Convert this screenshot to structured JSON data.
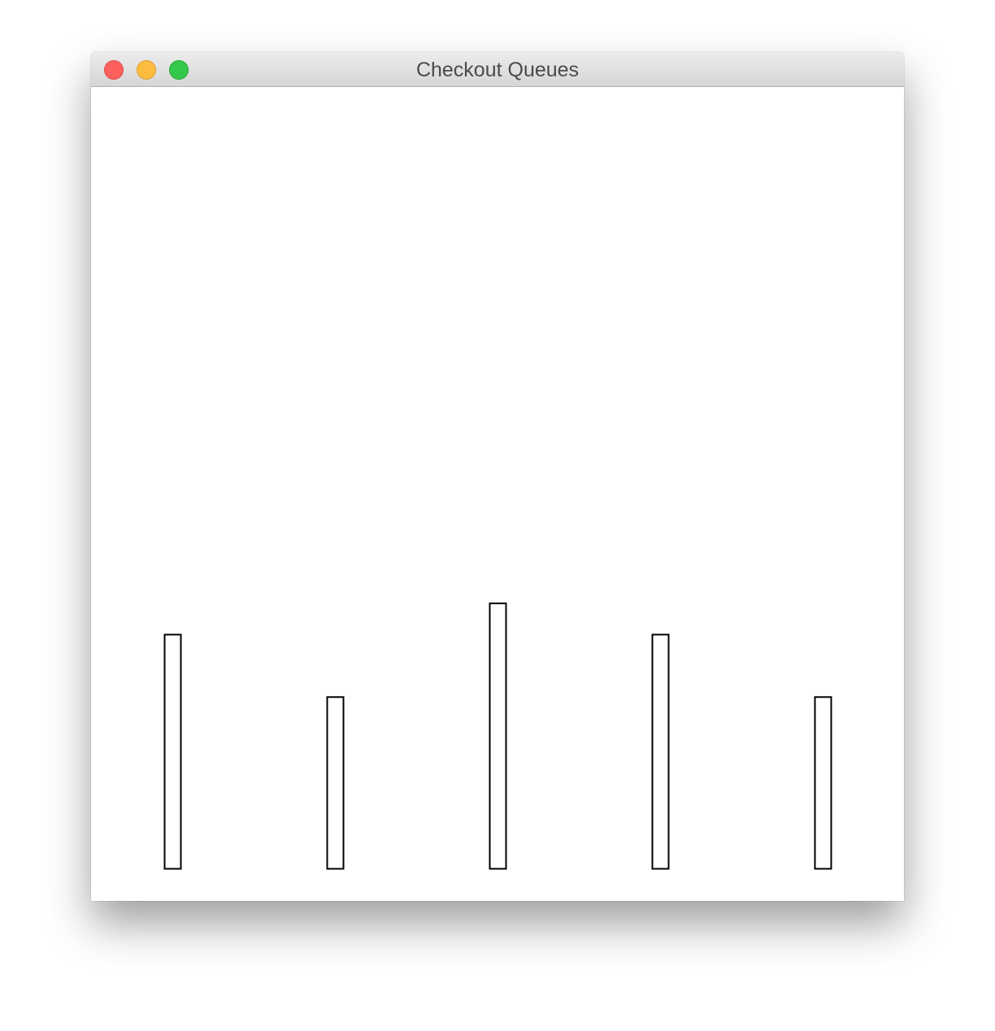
{
  "window": {
    "title": "Checkout Queues",
    "controls": {
      "close": {
        "color": "#fc605c"
      },
      "minimize": {
        "color": "#fdbc40"
      },
      "zoom": {
        "color": "#34c84a"
      }
    }
  },
  "chart_data": {
    "type": "bar",
    "categories": [
      "",
      "",
      "",
      "",
      ""
    ],
    "values": [
      15,
      11,
      17,
      15,
      11
    ],
    "ylim": [
      0,
      50
    ],
    "grid": false,
    "bar_fill": "#ffffff",
    "bar_stroke": "#000000"
  }
}
